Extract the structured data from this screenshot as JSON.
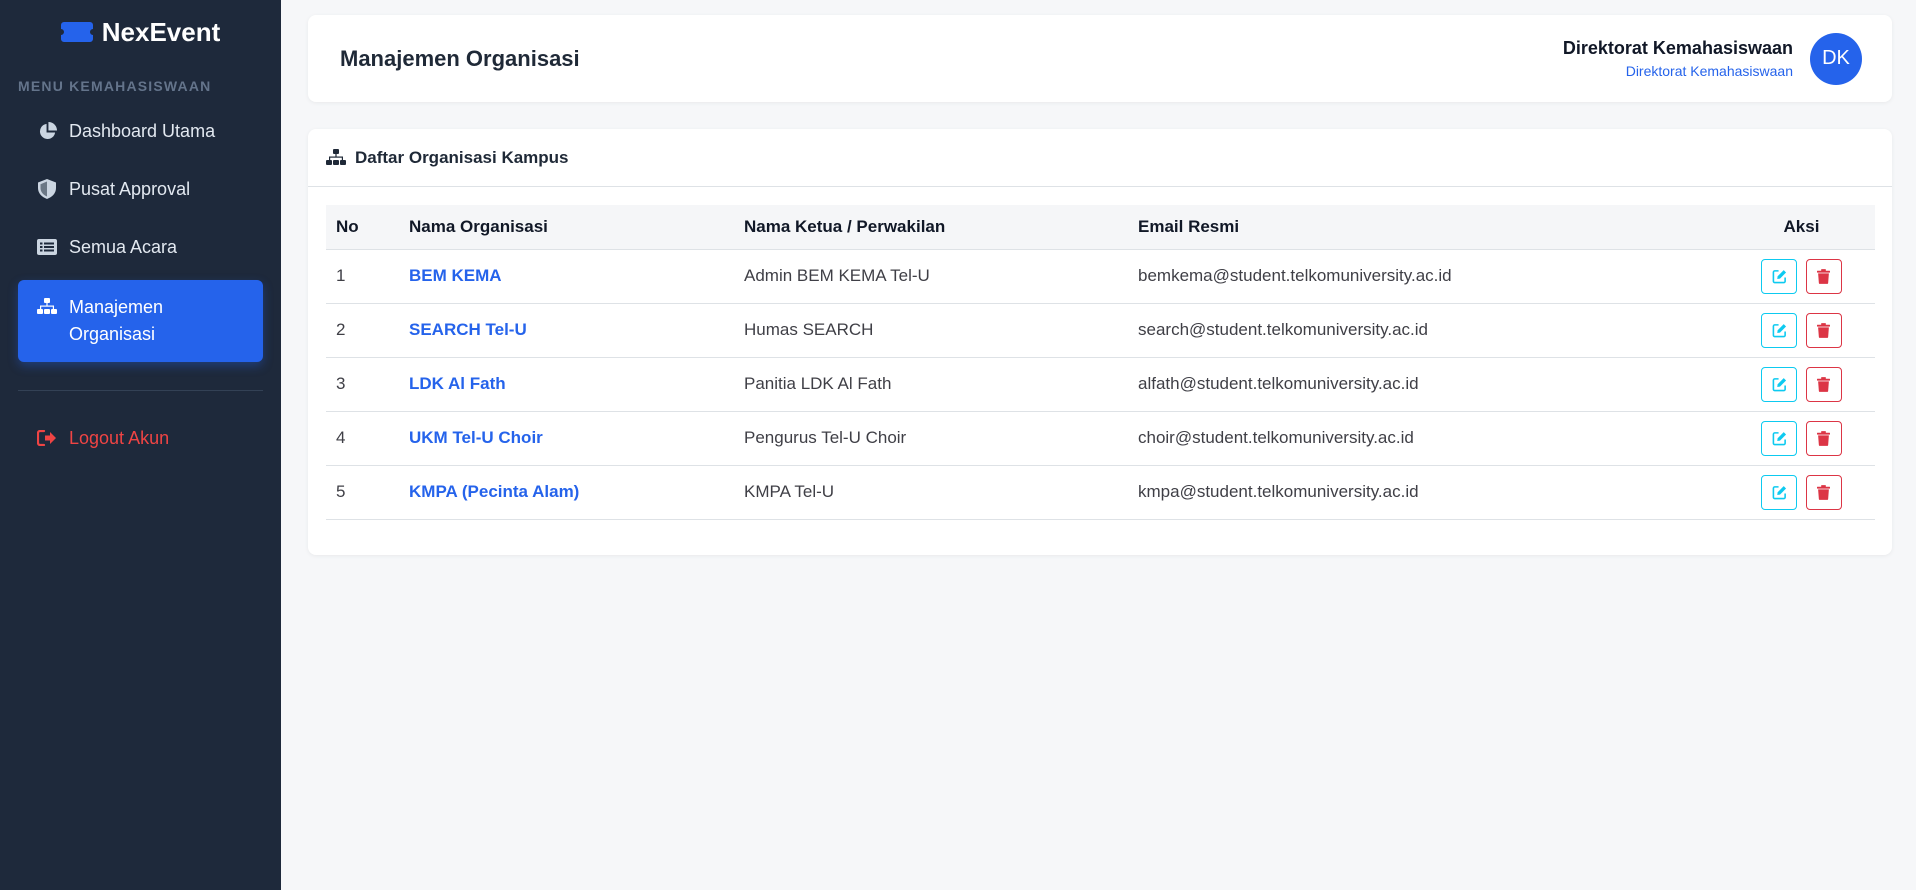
{
  "brand": {
    "name": "NexEvent"
  },
  "sidebar": {
    "heading": "MENU KEMAHASISWAAN",
    "items": [
      {
        "label": "Dashboard Utama",
        "icon": "pie-chart-icon"
      },
      {
        "label": "Pusat Approval",
        "icon": "shield-icon"
      },
      {
        "label": "Semua Acara",
        "icon": "list-icon"
      },
      {
        "label": "Manajemen Organisasi",
        "icon": "sitemap-icon",
        "active": true
      }
    ],
    "logout_label": "Logout Akun"
  },
  "header": {
    "title": "Manajemen Organisasi",
    "user_name": "Direktorat Kemahasiswaan",
    "user_role": "Direktorat Kemahasiswaan",
    "avatar_initials": "DK"
  },
  "card": {
    "title": "Daftar Organisasi Kampus",
    "columns": [
      "No",
      "Nama Organisasi",
      "Nama Ketua / Perwakilan",
      "Email Resmi",
      "Aksi"
    ],
    "rows": [
      {
        "no": "1",
        "name": "BEM KEMA",
        "leader": "Admin BEM KEMA Tel-U",
        "email": "bemkema@student.telkomuniversity.ac.id"
      },
      {
        "no": "2",
        "name": "SEARCH Tel-U",
        "leader": "Humas SEARCH",
        "email": "search@student.telkomuniversity.ac.id"
      },
      {
        "no": "3",
        "name": "LDK Al Fath",
        "leader": "Panitia LDK Al Fath",
        "email": "alfath@student.telkomuniversity.ac.id"
      },
      {
        "no": "4",
        "name": "UKM Tel-U Choir",
        "leader": "Pengurus Tel-U Choir",
        "email": "choir@student.telkomuniversity.ac.id"
      },
      {
        "no": "5",
        "name": "KMPA (Pecinta Alam)",
        "leader": "KMPA Tel-U",
        "email": "kmpa@student.telkomuniversity.ac.id"
      }
    ]
  },
  "colors": {
    "sidebar_bg": "#1e293b",
    "accent": "#2563eb",
    "edit": "#0dcaf0",
    "delete": "#dc3545",
    "logout": "#ef4444"
  }
}
